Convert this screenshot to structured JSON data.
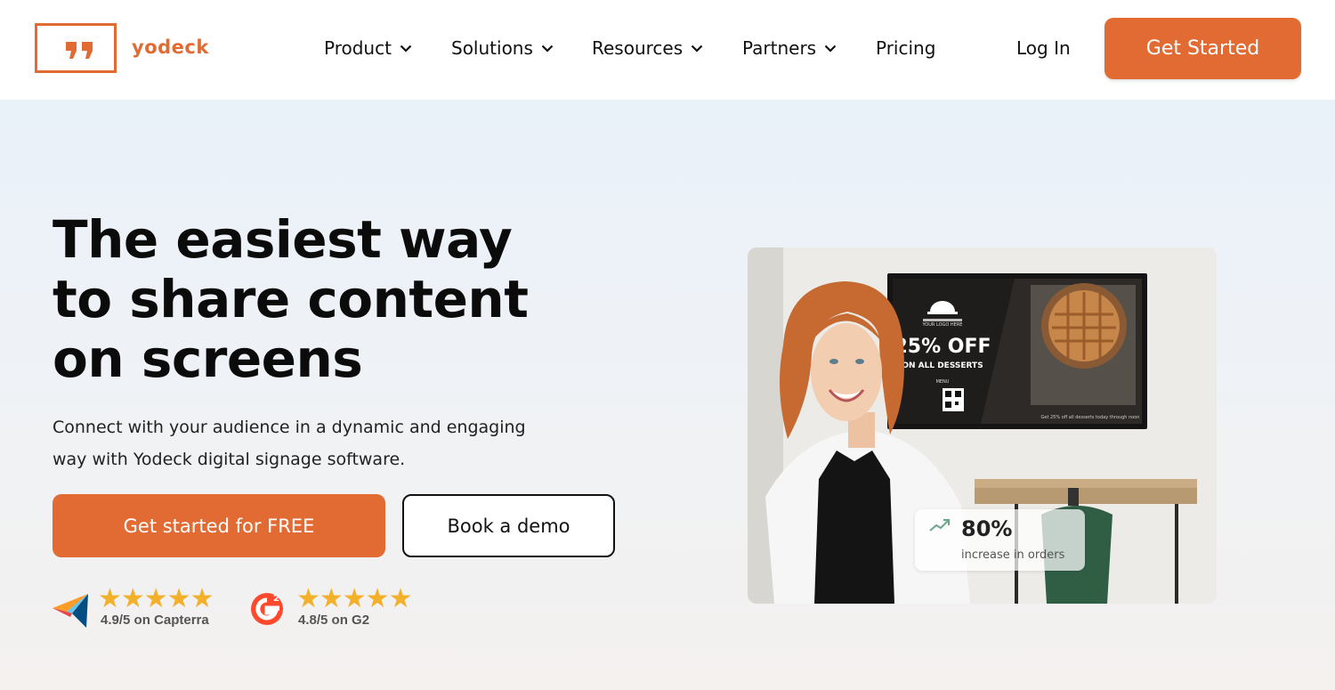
{
  "header": {
    "brand": "yodeck",
    "nav": [
      {
        "label": "Product",
        "has_dropdown": true
      },
      {
        "label": "Solutions",
        "has_dropdown": true
      },
      {
        "label": "Resources",
        "has_dropdown": true
      },
      {
        "label": "Partners",
        "has_dropdown": true
      },
      {
        "label": "Pricing",
        "has_dropdown": false
      }
    ],
    "login_label": "Log In",
    "cta_label": "Get Started"
  },
  "hero": {
    "headline_lines": [
      "The easiest way",
      "to share content",
      "on screens"
    ],
    "subtext_lines": [
      "Connect with your audience in a dynamic and engaging",
      "way with Yodeck digital signage software."
    ],
    "primary_cta": "Get started for FREE",
    "secondary_cta": "Book a demo",
    "ratings": [
      {
        "source_icon": "capterra-logo-icon",
        "stars": 5,
        "text": "4.9/5 on Capterra"
      },
      {
        "source_icon": "g2-logo-icon",
        "stars": 5,
        "text": "4.8/5 on G2"
      }
    ]
  },
  "hero_image": {
    "screen": {
      "logo_text": "YOUR LOGO HERE",
      "offer": "25% OFF",
      "offer_sub": "ON ALL DESSERTS",
      "menu_label": "MENU",
      "ticker": "Get 25% off all desserts today through noon"
    },
    "stat": {
      "value": "80%",
      "label": "increase in orders",
      "icon": "trending-up-icon"
    }
  },
  "colors": {
    "accent": "#e26b34",
    "star": "#f2b02b",
    "text": "#111111"
  }
}
